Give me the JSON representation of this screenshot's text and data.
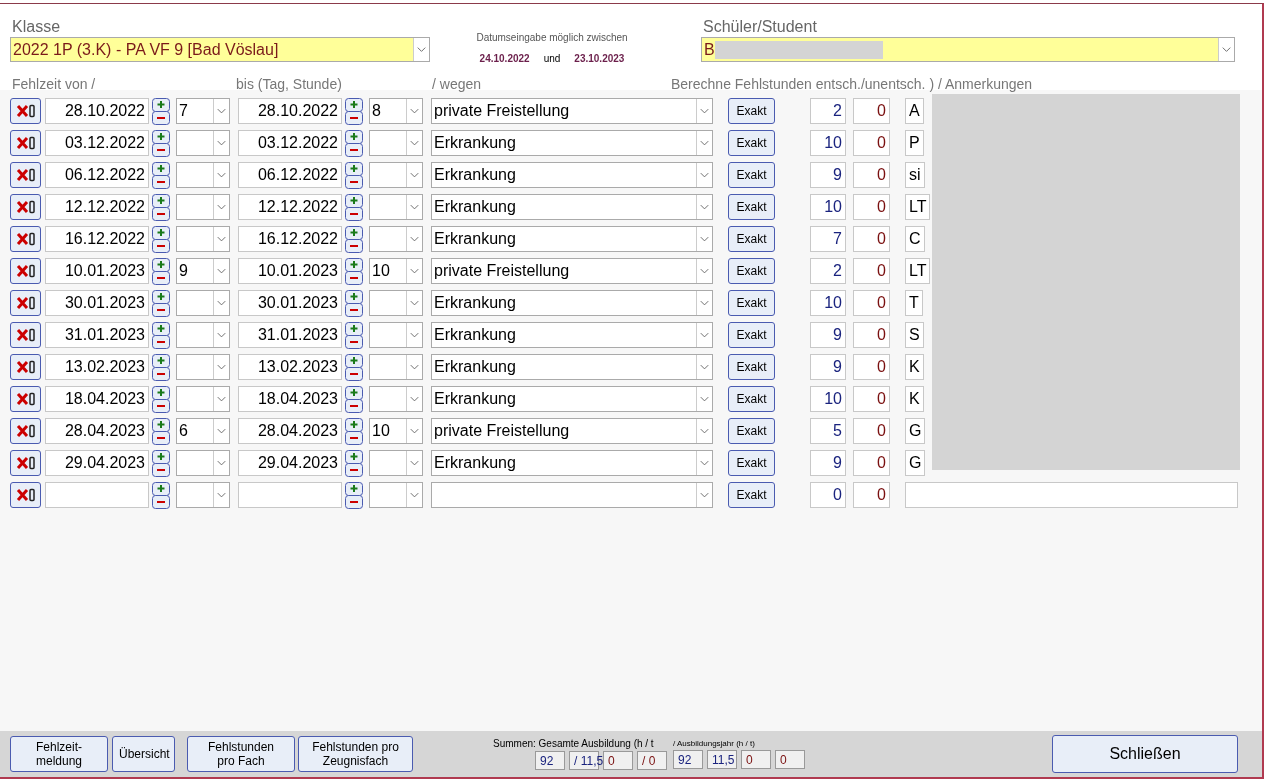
{
  "header": {
    "class_label": "Klasse",
    "class_value": "2022 1P (3.K) - PA VF 9  [Bad Vöslau]",
    "date_hint": "Datumseingabe möglich zwischen",
    "date_start": "24.10.2022",
    "date_and": "und",
    "date_end": "23.10.2023",
    "student_label": "Schüler/Student",
    "student_value": "B"
  },
  "columns": [
    "Fehlzeit von  /",
    "bis (Tag, Stunde)",
    "/ wegen",
    "Berechne Fehlstunden entsch./unentsch. )  / Anmerkungen"
  ],
  "rows": [
    {
      "from": "28.10.2022",
      "from_hour": "7",
      "to": "28.10.2022",
      "to_hour": "8",
      "reason": "private Freistellung",
      "button": "Exakt",
      "excused": "2",
      "unexcused": "0",
      "note": "A"
    },
    {
      "from": "03.12.2022",
      "to": "03.12.2022",
      "reason": "Erkrankung",
      "button": "Exakt",
      "excused": "10",
      "unexcused": "0",
      "note": "P"
    },
    {
      "from": "06.12.2022",
      "to": "06.12.2022",
      "reason": "Erkrankung",
      "button": "Exakt",
      "excused": "9",
      "unexcused": "0",
      "note": "si"
    },
    {
      "from": "12.12.2022",
      "to": "12.12.2022",
      "reason": "Erkrankung",
      "button": "Exakt",
      "excused": "10",
      "unexcused": "0",
      "note": "LT"
    },
    {
      "from": "16.12.2022",
      "to": "16.12.2022",
      "reason": "Erkrankung",
      "button": "Exakt",
      "excused": "7",
      "unexcused": "0",
      "note": "C"
    },
    {
      "from": "10.01.2023",
      "from_hour": "9",
      "to": "10.01.2023",
      "to_hour": "10",
      "reason": "private Freistellung",
      "button": "Exakt",
      "excused": "2",
      "unexcused": "0",
      "note": "LT"
    },
    {
      "from": "30.01.2023",
      "to": "30.01.2023",
      "reason": "Erkrankung",
      "button": "Exakt",
      "excused": "10",
      "unexcused": "0",
      "note": "T"
    },
    {
      "from": "31.01.2023",
      "to": "31.01.2023",
      "reason": "Erkrankung",
      "button": "Exakt",
      "excused": "9",
      "unexcused": "0",
      "note": "S"
    },
    {
      "from": "13.02.2023",
      "to": "13.02.2023",
      "reason": "Erkrankung",
      "button": "Exakt",
      "excused": "9",
      "unexcused": "0",
      "note": "K"
    },
    {
      "from": "18.04.2023",
      "to": "18.04.2023",
      "reason": "Erkrankung",
      "button": "Exakt",
      "excused": "10",
      "unexcused": "0",
      "note": "K"
    },
    {
      "from": "28.04.2023",
      "from_hour": "6",
      "to": "28.04.2023",
      "to_hour": "10",
      "reason": "private Freistellung",
      "button": "Exakt",
      "excused": "5",
      "unexcused": "0",
      "note": "G"
    },
    {
      "from": "29.04.2023",
      "to": "29.04.2023",
      "reason": "Erkrankung",
      "button": "Exakt",
      "excused": "9",
      "unexcused": "0",
      "note": "G"
    },
    {
      "button": "Exakt",
      "excused": "0",
      "unexcused": "0"
    }
  ],
  "footer": {
    "buttons": [
      "Fehlzeit-\nmeldung",
      "Übersicht",
      "Fehlstunden\npro Fach",
      "Fehlstunden pro\nZeugnisfach"
    ],
    "totals_label": "Summen: Gesamte Ausbildung (h / t",
    "totals": [
      {
        "text": "92",
        "kind": "excused"
      },
      {
        "text": "/ 11,5",
        "kind": "excused"
      },
      {
        "text": "0",
        "kind": "unexcused"
      },
      {
        "text": "/ 0",
        "kind": "unexcused"
      }
    ],
    "year_label": "/ Ausbildungsjahr (h / t)",
    "year": [
      {
        "text": "92",
        "kind": "excused"
      },
      {
        "text": "11,5",
        "kind": "excused"
      },
      {
        "text": "0",
        "kind": "unexcused"
      },
      {
        "text": "0",
        "kind": "unexcused"
      }
    ],
    "close": "Schließen"
  }
}
